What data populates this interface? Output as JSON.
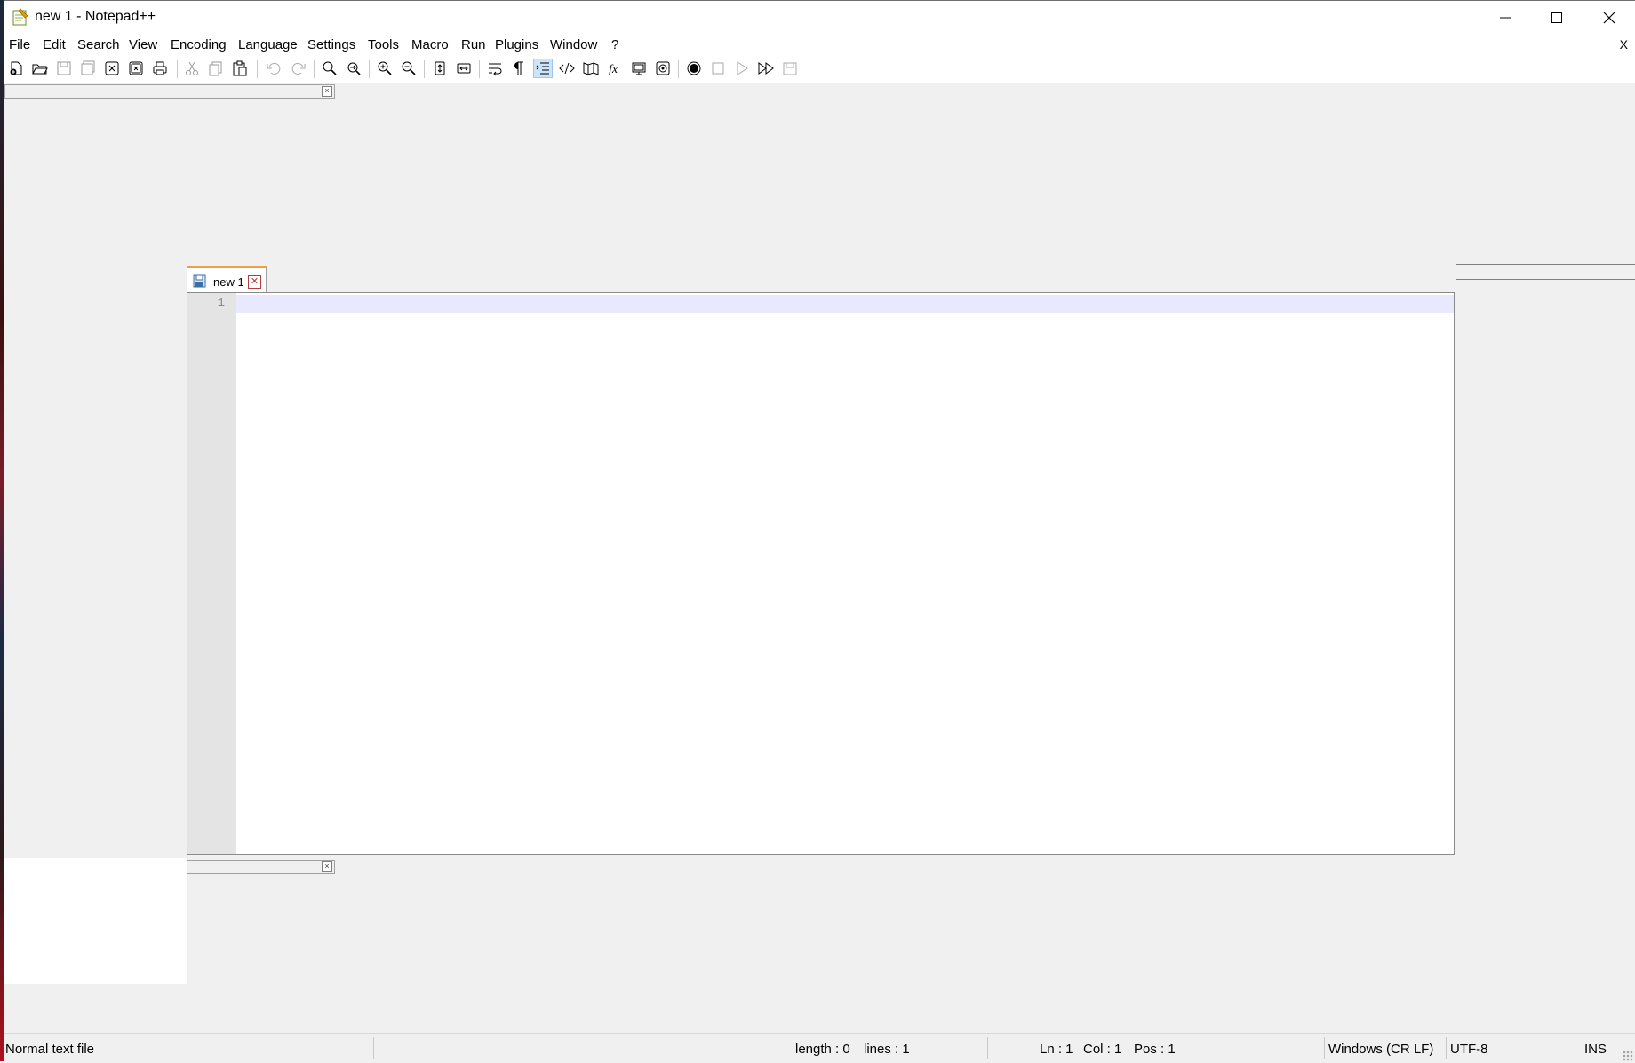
{
  "window": {
    "title": "new 1 - Notepad++"
  },
  "menu": {
    "items": [
      "File",
      "Edit",
      "Search",
      "View",
      "Encoding",
      "Language",
      "Settings",
      "Tools",
      "Macro",
      "Run",
      "Plugins",
      "Window",
      "?"
    ],
    "close_x": "X"
  },
  "toolbar": {
    "icons": [
      "new-file-icon",
      "open-file-icon",
      "save-icon",
      "save-all-icon",
      "close-icon",
      "close-all-icon",
      "print-icon",
      "cut-icon",
      "copy-icon",
      "paste-icon",
      "undo-icon",
      "redo-icon",
      "find-icon",
      "replace-icon",
      "zoom-in-icon",
      "zoom-out-icon",
      "sync-vertical-icon",
      "sync-horizontal-icon",
      "word-wrap-icon",
      "show-all-characters-icon",
      "indent-guide-icon",
      "xml-tag-icon",
      "document-map-icon",
      "function-list-icon",
      "folder-as-workspace-icon",
      "monitoring-icon",
      "record-macro-icon",
      "stop-recording-icon",
      "playback-macro-icon",
      "run-macro-multiple-icon",
      "save-macro-icon"
    ]
  },
  "tabs": [
    {
      "label": "new 1",
      "close": "✕"
    }
  ],
  "editor": {
    "line_numbers": [
      "1"
    ]
  },
  "dock": {
    "close_glyph": "×"
  },
  "status": {
    "file_type": "Normal text file",
    "length": "length : 0",
    "lines": "lines : 1",
    "ln": "Ln : 1",
    "col": "Col : 1",
    "pos": "Pos : 1",
    "eol": "Windows (CR LF)",
    "encoding": "UTF-8",
    "mode": "INS"
  },
  "colors": {
    "tab_accent": "#f0a040",
    "current_line": "#e8e8ff",
    "gutter": "#e4e4e4",
    "chrome": "#f0f0f0"
  }
}
